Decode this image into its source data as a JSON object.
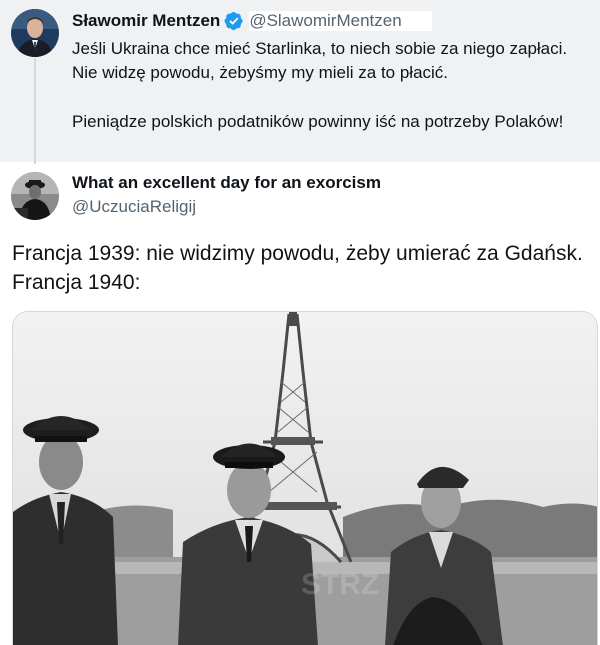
{
  "quoted_tweet": {
    "display_name": "Sławomir Mentzen",
    "handle": "@SlawomirMentzen",
    "verified_icon": "verified-badge-icon",
    "text_paragraph_1": "Jeśli Ukraina chce mieć Starlinka, to niech sobie za niego zapłaci. Nie widzę powodu, żebyśmy my mieli za to płacić.",
    "text_paragraph_2": "Pieniądze polskich podatników powinny iść na potrzeby Polaków!"
  },
  "reply_tweet": {
    "display_name": "What an excellent day for an exorcism",
    "handle": "@UczuciaReligij",
    "text": "Francja 1939: nie widzimy powodu, żeby umierać za Gdańsk.\nFrancja 1940:",
    "photo_watermark": "STRZ"
  },
  "colors": {
    "quoted_background": "#eff1f2",
    "secondary_text": "#536471",
    "verified_blue": "#1d9bf0"
  }
}
